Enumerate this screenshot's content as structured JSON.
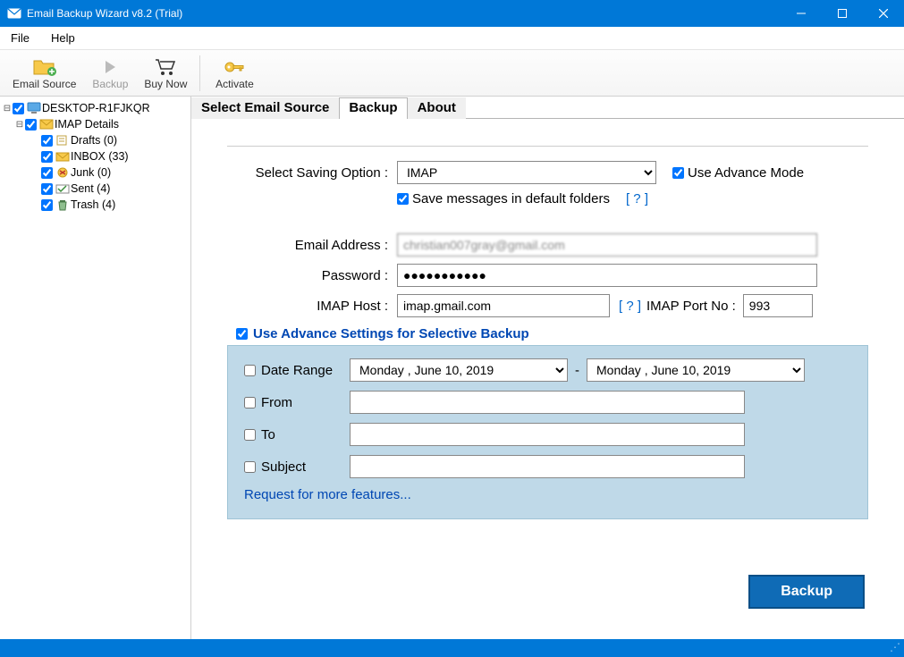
{
  "window": {
    "title": "Email Backup Wizard v8.2 (Trial)"
  },
  "menubar": {
    "file": "File",
    "help": "Help"
  },
  "toolbar": {
    "email_source": "Email Source",
    "backup": "Backup",
    "buy_now": "Buy Now",
    "activate": "Activate"
  },
  "tree": {
    "root": "DESKTOP-R1FJKQR",
    "account": "IMAP Details",
    "folders": [
      {
        "name": "Drafts (0)"
      },
      {
        "name": "INBOX (33)"
      },
      {
        "name": "Junk (0)"
      },
      {
        "name": "Sent (4)"
      },
      {
        "name": "Trash (4)"
      }
    ]
  },
  "tabs": {
    "select_source": "Select Email Source",
    "backup": "Backup",
    "about": "About"
  },
  "backup_pane": {
    "saving_label": "Select Saving Option :",
    "saving_value": "IMAP",
    "advance_mode": "Use Advance Mode",
    "save_default": "Save messages in default folders",
    "help1": "[ ? ]",
    "email_label": "Email Address :",
    "email_value": "christian007gray@gmail.com",
    "password_label": "Password :",
    "password_value": "●●●●●●●●●●●",
    "host_label": "IMAP Host :",
    "host_value": "imap.gmail.com",
    "help2": "[ ? ]",
    "port_label": "IMAP Port No :",
    "port_value": "993",
    "adv_title": "Use Advance Settings for Selective Backup",
    "date_range": "Date Range",
    "date_from": "Monday   ,      June     10, 2019",
    "date_sep": "-",
    "date_to": "Monday   ,      June     10, 2019",
    "from": "From",
    "to": "To",
    "subject": "Subject",
    "request_link": "Request for more features...",
    "backup_btn": "Backup"
  }
}
